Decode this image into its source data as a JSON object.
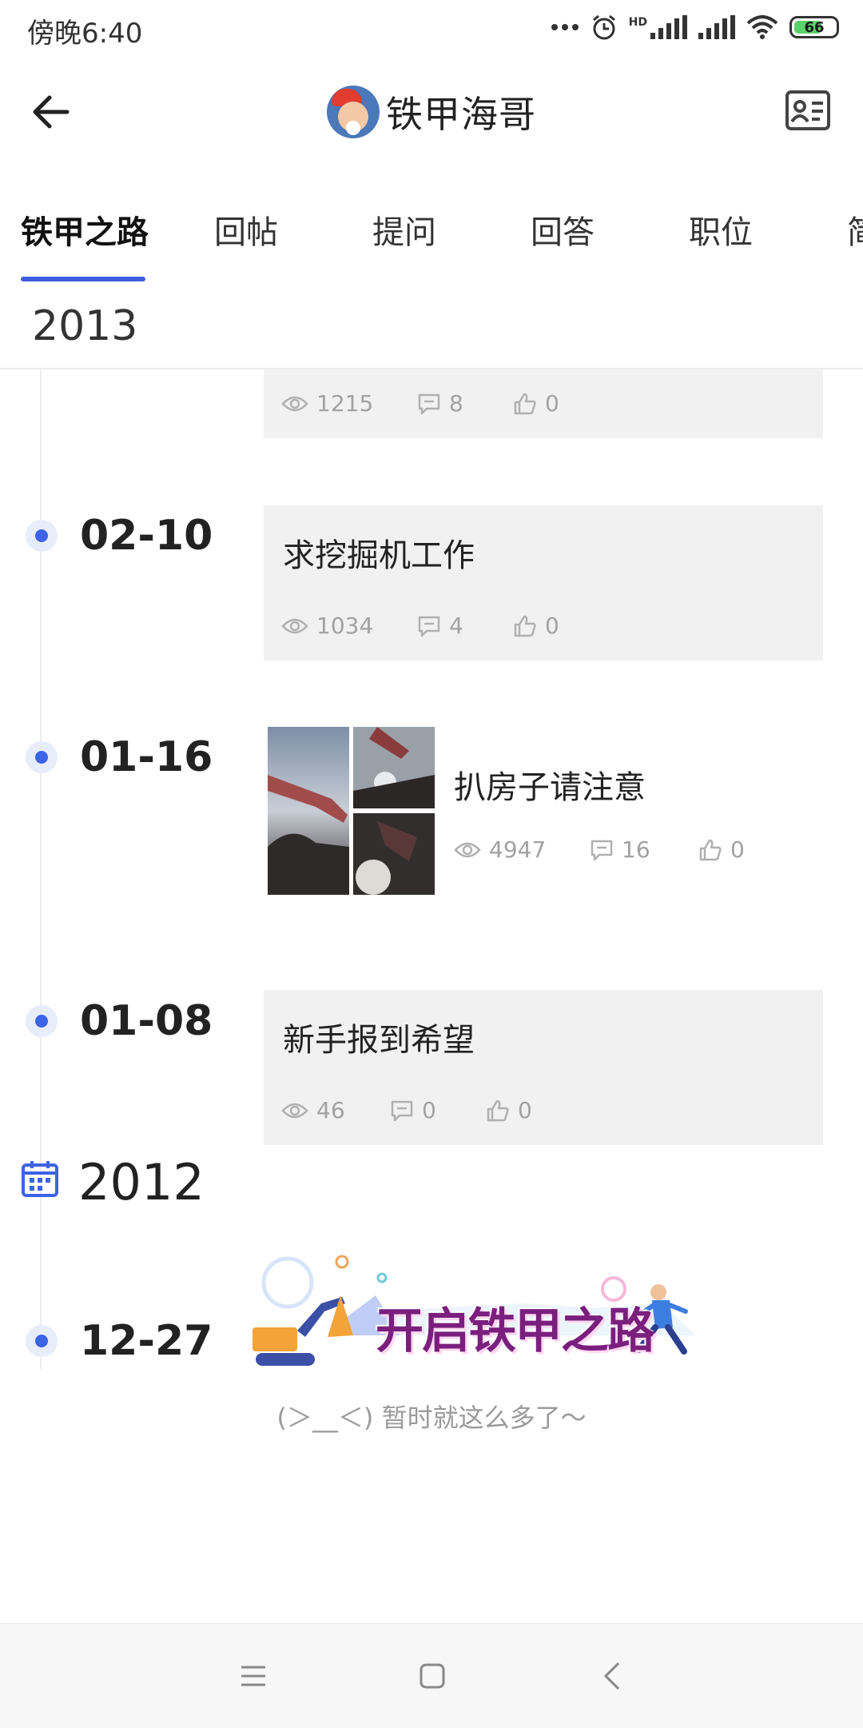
{
  "status_bar": {
    "time": "傍晚6:40",
    "battery": "66",
    "icons": [
      "dots-icon",
      "alarm-icon",
      "hd-signal-icon",
      "signal-icon",
      "wifi-icon",
      "battery-icon"
    ]
  },
  "header": {
    "title": "铁甲海哥",
    "back_icon": "arrow-left-icon",
    "right_icon": "contact-card-icon"
  },
  "tabs": [
    {
      "label": "铁甲之路",
      "active": true
    },
    {
      "label": "回帖",
      "active": false
    },
    {
      "label": "提问",
      "active": false
    },
    {
      "label": "回答",
      "active": false
    },
    {
      "label": "职位",
      "active": false
    },
    {
      "label": "简",
      "active": false
    }
  ],
  "timeline": {
    "year_2013": "2013",
    "year_2012": "2012",
    "partial_card": {
      "views": "1215",
      "comments": "8",
      "likes": "0"
    },
    "entries": [
      {
        "date": "02-10",
        "title": "求挖掘机工作",
        "views": "1034",
        "comments": "4",
        "likes": "0"
      },
      {
        "date": "01-16",
        "title": "扒房子请注意",
        "views": "4947",
        "comments": "16",
        "likes": "0"
      },
      {
        "date": "01-08",
        "title": "新手报到希望",
        "views": "46",
        "comments": "0",
        "likes": "0"
      }
    ],
    "entry_2012": {
      "date": "12-27",
      "banner_text": "开启铁甲之路"
    }
  },
  "footer": {
    "end_text": "(＞__＜) 暂时就这么多了～"
  },
  "nav_bar": {
    "icons": [
      "menu-icon",
      "home-square-icon",
      "back-chevron-icon"
    ]
  },
  "colors": {
    "accent": "#3d5fe0",
    "card_bg": "#f1f1f1",
    "stat_text": "#a2a2a2",
    "banner_title": "#7a1f7e"
  }
}
